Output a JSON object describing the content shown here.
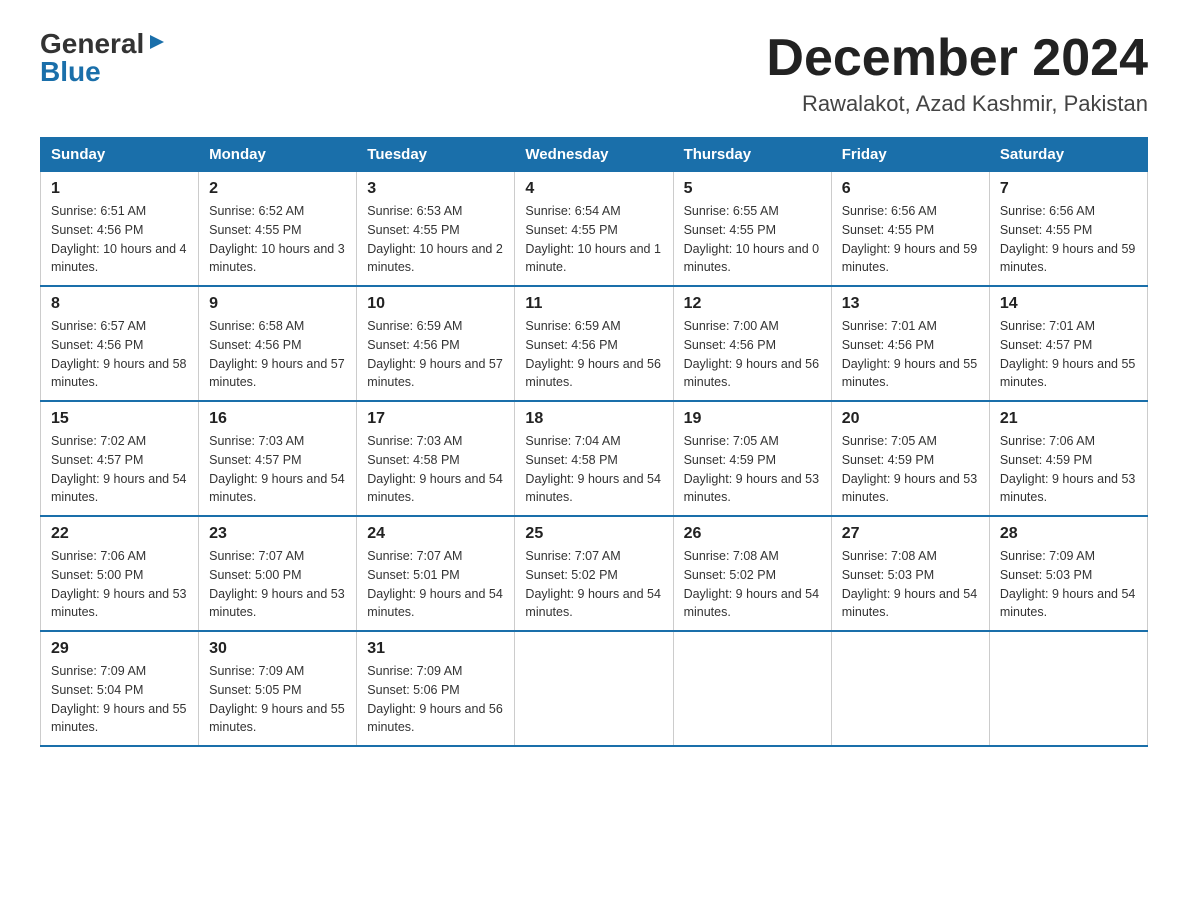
{
  "header": {
    "logo_general": "General",
    "logo_blue": "Blue",
    "month_title": "December 2024",
    "location": "Rawalakot, Azad Kashmir, Pakistan"
  },
  "days_of_week": [
    "Sunday",
    "Monday",
    "Tuesday",
    "Wednesday",
    "Thursday",
    "Friday",
    "Saturday"
  ],
  "weeks": [
    [
      {
        "day": "1",
        "sunrise": "6:51 AM",
        "sunset": "4:56 PM",
        "daylight": "10 hours and 4 minutes."
      },
      {
        "day": "2",
        "sunrise": "6:52 AM",
        "sunset": "4:55 PM",
        "daylight": "10 hours and 3 minutes."
      },
      {
        "day": "3",
        "sunrise": "6:53 AM",
        "sunset": "4:55 PM",
        "daylight": "10 hours and 2 minutes."
      },
      {
        "day": "4",
        "sunrise": "6:54 AM",
        "sunset": "4:55 PM",
        "daylight": "10 hours and 1 minute."
      },
      {
        "day": "5",
        "sunrise": "6:55 AM",
        "sunset": "4:55 PM",
        "daylight": "10 hours and 0 minutes."
      },
      {
        "day": "6",
        "sunrise": "6:56 AM",
        "sunset": "4:55 PM",
        "daylight": "9 hours and 59 minutes."
      },
      {
        "day": "7",
        "sunrise": "6:56 AM",
        "sunset": "4:55 PM",
        "daylight": "9 hours and 59 minutes."
      }
    ],
    [
      {
        "day": "8",
        "sunrise": "6:57 AM",
        "sunset": "4:56 PM",
        "daylight": "9 hours and 58 minutes."
      },
      {
        "day": "9",
        "sunrise": "6:58 AM",
        "sunset": "4:56 PM",
        "daylight": "9 hours and 57 minutes."
      },
      {
        "day": "10",
        "sunrise": "6:59 AM",
        "sunset": "4:56 PM",
        "daylight": "9 hours and 57 minutes."
      },
      {
        "day": "11",
        "sunrise": "6:59 AM",
        "sunset": "4:56 PM",
        "daylight": "9 hours and 56 minutes."
      },
      {
        "day": "12",
        "sunrise": "7:00 AM",
        "sunset": "4:56 PM",
        "daylight": "9 hours and 56 minutes."
      },
      {
        "day": "13",
        "sunrise": "7:01 AM",
        "sunset": "4:56 PM",
        "daylight": "9 hours and 55 minutes."
      },
      {
        "day": "14",
        "sunrise": "7:01 AM",
        "sunset": "4:57 PM",
        "daylight": "9 hours and 55 minutes."
      }
    ],
    [
      {
        "day": "15",
        "sunrise": "7:02 AM",
        "sunset": "4:57 PM",
        "daylight": "9 hours and 54 minutes."
      },
      {
        "day": "16",
        "sunrise": "7:03 AM",
        "sunset": "4:57 PM",
        "daylight": "9 hours and 54 minutes."
      },
      {
        "day": "17",
        "sunrise": "7:03 AM",
        "sunset": "4:58 PM",
        "daylight": "9 hours and 54 minutes."
      },
      {
        "day": "18",
        "sunrise": "7:04 AM",
        "sunset": "4:58 PM",
        "daylight": "9 hours and 54 minutes."
      },
      {
        "day": "19",
        "sunrise": "7:05 AM",
        "sunset": "4:59 PM",
        "daylight": "9 hours and 53 minutes."
      },
      {
        "day": "20",
        "sunrise": "7:05 AM",
        "sunset": "4:59 PM",
        "daylight": "9 hours and 53 minutes."
      },
      {
        "day": "21",
        "sunrise": "7:06 AM",
        "sunset": "4:59 PM",
        "daylight": "9 hours and 53 minutes."
      }
    ],
    [
      {
        "day": "22",
        "sunrise": "7:06 AM",
        "sunset": "5:00 PM",
        "daylight": "9 hours and 53 minutes."
      },
      {
        "day": "23",
        "sunrise": "7:07 AM",
        "sunset": "5:00 PM",
        "daylight": "9 hours and 53 minutes."
      },
      {
        "day": "24",
        "sunrise": "7:07 AM",
        "sunset": "5:01 PM",
        "daylight": "9 hours and 54 minutes."
      },
      {
        "day": "25",
        "sunrise": "7:07 AM",
        "sunset": "5:02 PM",
        "daylight": "9 hours and 54 minutes."
      },
      {
        "day": "26",
        "sunrise": "7:08 AM",
        "sunset": "5:02 PM",
        "daylight": "9 hours and 54 minutes."
      },
      {
        "day": "27",
        "sunrise": "7:08 AM",
        "sunset": "5:03 PM",
        "daylight": "9 hours and 54 minutes."
      },
      {
        "day": "28",
        "sunrise": "7:09 AM",
        "sunset": "5:03 PM",
        "daylight": "9 hours and 54 minutes."
      }
    ],
    [
      {
        "day": "29",
        "sunrise": "7:09 AM",
        "sunset": "5:04 PM",
        "daylight": "9 hours and 55 minutes."
      },
      {
        "day": "30",
        "sunrise": "7:09 AM",
        "sunset": "5:05 PM",
        "daylight": "9 hours and 55 minutes."
      },
      {
        "day": "31",
        "sunrise": "7:09 AM",
        "sunset": "5:06 PM",
        "daylight": "9 hours and 56 minutes."
      },
      null,
      null,
      null,
      null
    ]
  ]
}
